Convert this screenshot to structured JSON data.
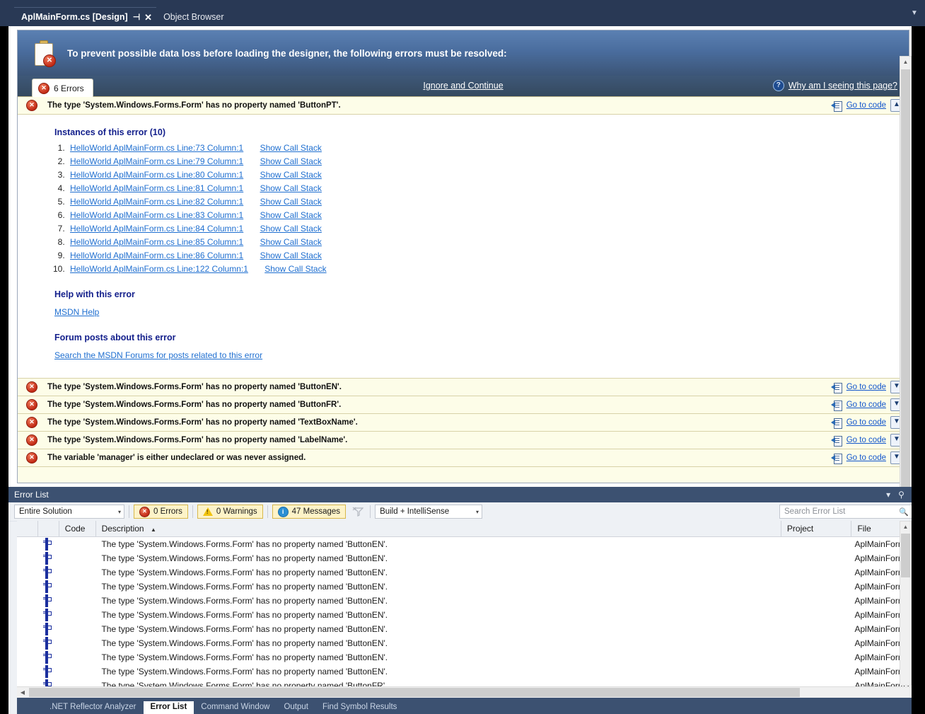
{
  "tabbar": {
    "tabs": [
      {
        "label": "AplMainForm.cs [Design]",
        "active": true
      },
      {
        "label": "Object Browser",
        "active": false
      }
    ],
    "pin_glyph": "⊣",
    "close_glyph": "✕",
    "overflow_glyph": "▼"
  },
  "designer": {
    "banner_text": "To prevent possible data loss before loading the designer, the following errors must be resolved:",
    "errors_tab_label": "6 Errors",
    "error_badge_glyph": "✕",
    "ignore_and_continue": "Ignore and Continue",
    "why_link": "Why am I seeing this page?",
    "why_icon_glyph": "?",
    "goto_code_label": "Go to code",
    "collapse_glyph": "▲",
    "expand_glyph": "▼",
    "expanded_error": {
      "message": "The type 'System.Windows.Forms.Form' has no property named 'ButtonPT'.",
      "instances_title": "Instances of this error (10)",
      "instances": [
        {
          "location": "HelloWorld AplMainForm.cs Line:73 Column:1",
          "action": "Show Call Stack"
        },
        {
          "location": "HelloWorld AplMainForm.cs Line:79 Column:1",
          "action": "Show Call Stack"
        },
        {
          "location": "HelloWorld AplMainForm.cs Line:80 Column:1",
          "action": "Show Call Stack"
        },
        {
          "location": "HelloWorld AplMainForm.cs Line:81 Column:1",
          "action": "Show Call Stack"
        },
        {
          "location": "HelloWorld AplMainForm.cs Line:82 Column:1",
          "action": "Show Call Stack"
        },
        {
          "location": "HelloWorld AplMainForm.cs Line:83 Column:1",
          "action": "Show Call Stack"
        },
        {
          "location": "HelloWorld AplMainForm.cs Line:84 Column:1",
          "action": "Show Call Stack"
        },
        {
          "location": "HelloWorld AplMainForm.cs Line:85 Column:1",
          "action": "Show Call Stack"
        },
        {
          "location": "HelloWorld AplMainForm.cs Line:86 Column:1",
          "action": "Show Call Stack"
        },
        {
          "location": "HelloWorld AplMainForm.cs Line:122 Column:1",
          "action": "Show Call Stack"
        }
      ],
      "help_title": "Help with this error",
      "help_link": "MSDN Help",
      "forum_title": "Forum posts about this error",
      "forum_link": "Search the MSDN Forums for posts related to this error"
    },
    "collapsed_errors": [
      {
        "message": "The type 'System.Windows.Forms.Form' has no property named 'ButtonEN'."
      },
      {
        "message": "The type 'System.Windows.Forms.Form' has no property named 'ButtonFR'."
      },
      {
        "message": "The type 'System.Windows.Forms.Form' has no property named 'TextBoxName'."
      },
      {
        "message": "The type 'System.Windows.Forms.Form' has no property named 'LabelName'."
      },
      {
        "message": "The variable 'manager' is either undeclared or was never assigned."
      }
    ]
  },
  "error_list": {
    "title": "Error List",
    "window_controls": {
      "dropdown": "▾",
      "pin": "📌",
      "close": "✕"
    },
    "scope_filter": "Entire Solution",
    "errors_toggle": "0 Errors",
    "warnings_toggle": "0 Warnings",
    "messages_toggle": "47 Messages",
    "clear_filter_glyph": "⌄",
    "build_filter": "Build + IntelliSense",
    "search_placeholder": "Search Error List",
    "search_icon_glyph": "⌕",
    "columns": [
      "",
      "",
      "Code",
      "Description",
      "Project",
      "File"
    ],
    "sort_column": "Description",
    "sort_direction_glyph": "▲",
    "rows": [
      {
        "code": "",
        "description": "The type 'System.Windows.Forms.Form' has no property named 'ButtonEN'.",
        "project": "",
        "file": "AplMainForm.cs"
      },
      {
        "code": "",
        "description": "The type 'System.Windows.Forms.Form' has no property named 'ButtonEN'.",
        "project": "",
        "file": "AplMainForm.cs"
      },
      {
        "code": "",
        "description": "The type 'System.Windows.Forms.Form' has no property named 'ButtonEN'.",
        "project": "",
        "file": "AplMainForm.cs"
      },
      {
        "code": "",
        "description": "The type 'System.Windows.Forms.Form' has no property named 'ButtonEN'.",
        "project": "",
        "file": "AplMainForm.cs"
      },
      {
        "code": "",
        "description": "The type 'System.Windows.Forms.Form' has no property named 'ButtonEN'.",
        "project": "",
        "file": "AplMainForm.cs"
      },
      {
        "code": "",
        "description": "The type 'System.Windows.Forms.Form' has no property named 'ButtonEN'.",
        "project": "",
        "file": "AplMainForm.cs"
      },
      {
        "code": "",
        "description": "The type 'System.Windows.Forms.Form' has no property named 'ButtonEN'.",
        "project": "",
        "file": "AplMainForm.cs"
      },
      {
        "code": "",
        "description": "The type 'System.Windows.Forms.Form' has no property named 'ButtonEN'.",
        "project": "",
        "file": "AplMainForm.cs"
      },
      {
        "code": "",
        "description": "The type 'System.Windows.Forms.Form' has no property named 'ButtonEN'.",
        "project": "",
        "file": "AplMainForm.cs"
      },
      {
        "code": "",
        "description": "The type 'System.Windows.Forms.Form' has no property named 'ButtonEN'.",
        "project": "",
        "file": "AplMainForm.cs"
      },
      {
        "code": "",
        "description": "The type 'System.Windows.Forms.Form' has no property named 'ButtonFR'.",
        "project": "",
        "file": "AplMainForm.cs"
      }
    ]
  },
  "bottom_tabs": [
    {
      "label": ".NET Reflector Analyzer",
      "active": false
    },
    {
      "label": "Error List",
      "active": true
    },
    {
      "label": "Command Window",
      "active": false
    },
    {
      "label": "Output",
      "active": false
    },
    {
      "label": "Find Symbol Results",
      "active": false
    }
  ],
  "colors": {
    "tabbar_bg": "#293955",
    "banner_top": "#5b80b2",
    "banner_bottom": "#3c5577",
    "error_row_bg": "#fdfde8",
    "link": "#1f6fd0",
    "section_title": "#14208c",
    "panel_header": "#3c5171",
    "toggle_bg": "#fdf3c8"
  }
}
